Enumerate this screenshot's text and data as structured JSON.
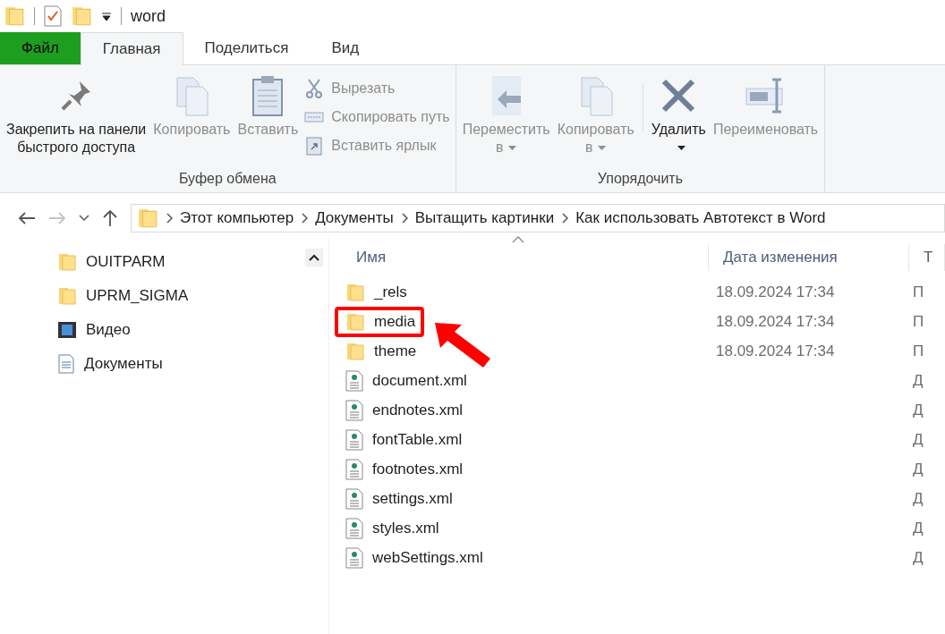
{
  "window": {
    "title": "word"
  },
  "tabs": [
    {
      "label": "Файл",
      "kind": "file",
      "selected": false
    },
    {
      "label": "Главная",
      "kind": "tab",
      "selected": true
    },
    {
      "label": "Поделиться",
      "kind": "tab",
      "selected": false
    },
    {
      "label": "Вид",
      "kind": "tab",
      "selected": false
    }
  ],
  "ribbon": {
    "groups": [
      {
        "label": "Буфер обмена",
        "buttons": [
          {
            "kind": "pin",
            "lines": [
              "Закрепить на панели",
              "быстрого доступа"
            ],
            "disabled": false
          },
          {
            "kind": "copy",
            "lines": [
              "Копировать"
            ],
            "disabled": true
          },
          {
            "kind": "paste",
            "lines": [
              "Вставить"
            ],
            "disabled": true
          }
        ],
        "small_buttons": [
          {
            "kind": "cut",
            "label": "Вырезать",
            "disabled": true
          },
          {
            "kind": "copy-path",
            "label": "Скопировать путь",
            "disabled": true
          },
          {
            "kind": "paste-shortcut",
            "label": "Вставить ярлык",
            "disabled": true
          }
        ]
      },
      {
        "label": "Упорядочить",
        "buttons": [
          {
            "kind": "move",
            "lines": [
              "Переместить",
              "в"
            ],
            "dropdown": true,
            "disabled": true
          },
          {
            "kind": "copy-to",
            "lines": [
              "Копировать",
              "в"
            ],
            "dropdown": true,
            "disabled": true
          },
          {
            "kind": "delete",
            "lines": [
              "Удалить"
            ],
            "dropdown": true,
            "disabled": false,
            "separator_before": true
          },
          {
            "kind": "rename",
            "lines": [
              "Переименовать"
            ],
            "disabled": true
          }
        ]
      }
    ]
  },
  "navigation": {
    "back_disabled": false,
    "forward_disabled": true
  },
  "breadcrumb": [
    "Этот компьютер",
    "Документы",
    "Вытащить картинки",
    "Как использовать Автотекст в Word"
  ],
  "sidebar": {
    "items": [
      {
        "label": "OUITPARM",
        "kind": "folder"
      },
      {
        "label": "UPRM_SIGMA",
        "kind": "folder"
      },
      {
        "label": "Видео",
        "kind": "video"
      },
      {
        "label": "Документы",
        "kind": "documents"
      }
    ]
  },
  "table": {
    "columns": [
      "Имя",
      "Дата изменения",
      "Т"
    ],
    "rows": [
      {
        "name": "_rels",
        "kind": "folder",
        "date": "18.09.2024 17:34",
        "type": "П",
        "highlighted": false
      },
      {
        "name": "media",
        "kind": "folder",
        "date": "18.09.2024 17:34",
        "type": "П",
        "highlighted": true
      },
      {
        "name": "theme",
        "kind": "folder",
        "date": "18.09.2024 17:34",
        "type": "П",
        "highlighted": false
      },
      {
        "name": "document.xml",
        "kind": "xml",
        "type": "Д",
        "highlighted": false
      },
      {
        "name": "endnotes.xml",
        "kind": "xml",
        "type": "Д",
        "highlighted": false
      },
      {
        "name": "fontTable.xml",
        "kind": "xml",
        "type": "Д",
        "highlighted": false
      },
      {
        "name": "footnotes.xml",
        "kind": "xml",
        "type": "Д",
        "highlighted": false
      },
      {
        "name": "settings.xml",
        "kind": "xml",
        "type": "Д",
        "highlighted": false
      },
      {
        "name": "styles.xml",
        "kind": "xml",
        "type": "Д",
        "highlighted": false
      },
      {
        "name": "webSettings.xml",
        "kind": "xml",
        "type": "Д",
        "highlighted": false
      }
    ]
  }
}
